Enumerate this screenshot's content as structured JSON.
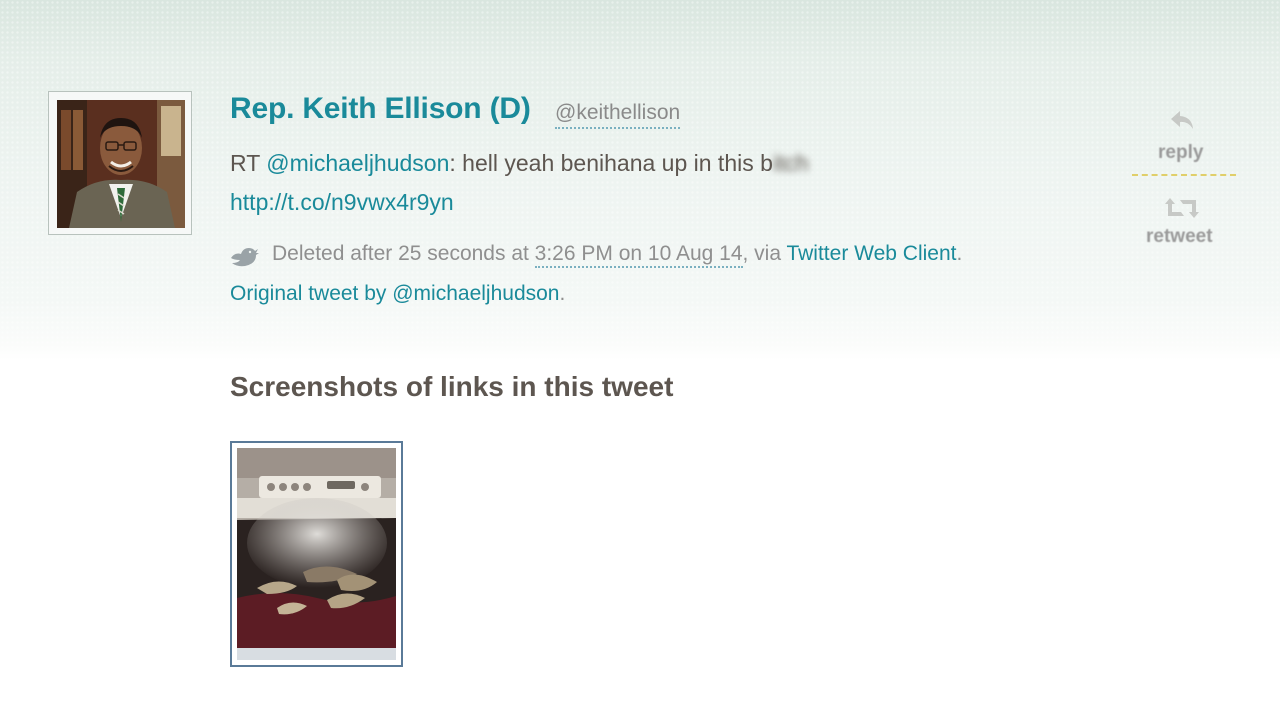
{
  "tweet": {
    "author_name": "Rep. Keith Ellison (D)",
    "author_handle": "@keithellison",
    "text_prefix": "RT ",
    "text_mention": "@michaeljhudson",
    "text_body": ": hell yeah benihana up in this b",
    "text_blurred": "itch",
    "link": "http://t.co/n9vwx4r9yn",
    "meta": {
      "deleted_prefix": "Deleted after 25 seconds at ",
      "time": "3:26 PM on 10 Aug 14",
      "via": ", via ",
      "client": "Twitter Web Client",
      "end": "."
    },
    "original": {
      "label": "Original tweet by @michaeljhudson",
      "end": "."
    }
  },
  "actions": {
    "reply_label": "reply",
    "retweet_label": "retweet",
    "reply_icon": "reply-arrow-icon",
    "retweet_icon": "retweet-icon"
  },
  "screenshots": {
    "title": "Screenshots of links in this tweet"
  },
  "colors": {
    "link": "#1a8a9a",
    "text": "#5d5650",
    "muted": "#8f8f8f",
    "divider": "#e0cf6a",
    "thumb_border": "#5a7a98"
  }
}
